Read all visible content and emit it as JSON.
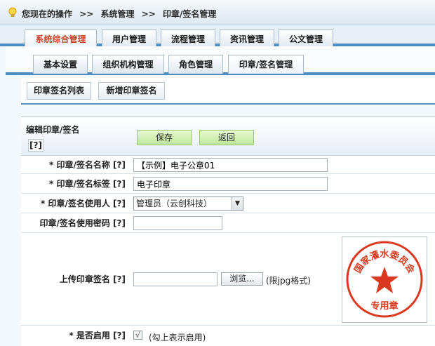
{
  "breadcrumb": {
    "prefix": "您现在的操作",
    "sep": ">>",
    "level1": "系统管理",
    "level2": "印章/签名管理"
  },
  "main_tabs": [
    "系统综合管理",
    "用户管理",
    "流程管理",
    "资讯管理",
    "公文管理"
  ],
  "sub_tabs": [
    "基本设置",
    "组织机构管理",
    "角色管理",
    "印章/签名管理"
  ],
  "sub_buttons": {
    "list": "印章签名列表",
    "add": "新增印章签名"
  },
  "form": {
    "title": "编辑印章/签名",
    "help": "[?]",
    "save": "保存",
    "back": "返回",
    "name_label": "* 印章/签名名称 [?]",
    "name_value": "【示例】电子公章01",
    "tag_label": "* 印章/签名标签 [?]",
    "tag_value": "电子印章",
    "user_label": "* 印章/签名使用人 [?]",
    "user_value": "管理员（云创科技）",
    "password_label": "印章/签名使用密码 [?]",
    "password_value": "",
    "upload_label": "上传印章签名 [?]",
    "browse": "浏览...",
    "upload_hint": "(限jpg格式)",
    "enable_label": "* 是否启用 [?]",
    "enable_checked": "√",
    "enable_hint": "(勾上表示启用)"
  },
  "stamp": {
    "ring_text": "国家灌水委员会",
    "bottom_text": "专用章",
    "color": "#d9391f"
  },
  "colors": {
    "active_tab": "#c8452a",
    "tab_border": "#4e8cc4"
  }
}
